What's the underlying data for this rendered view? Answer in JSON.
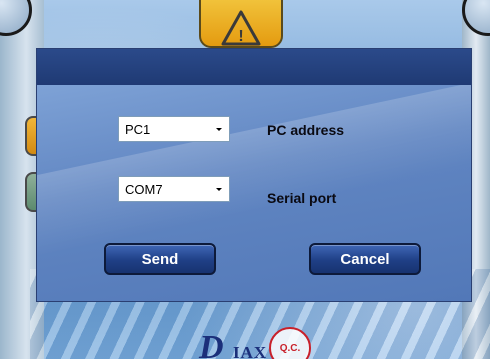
{
  "dialog": {
    "address": {
      "selected": "PC1",
      "label": "PC address"
    },
    "port": {
      "selected": "COM7",
      "label": "Serial port"
    },
    "send_label": "Send",
    "cancel_label": "Cancel"
  },
  "background": {
    "logo_letter": "D",
    "logo_text": "IAX",
    "seal_text": "Q.C.",
    "warning_glyph": "!"
  },
  "colors": {
    "dialog_title": "#1f3a74",
    "button": "#1f3f86",
    "warning": "#f1c23a"
  }
}
